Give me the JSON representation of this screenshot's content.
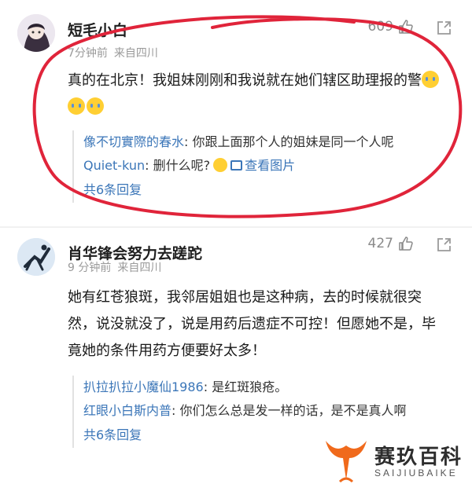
{
  "comments": [
    {
      "username": "短毛小白",
      "time": "7分钟前",
      "location": "来自四川",
      "likes": "609",
      "text": "真的在北京！我姐妹刚刚和我说就在她们辖区助理报的警",
      "replies": [
        {
          "author": "像不切實際的春水",
          "text": ": 你跟上面那个人的姐妹是同一个人呢"
        },
        {
          "author": "Quiet-kun",
          "text": ": 删什么呢?",
          "image_link": "查看图片"
        }
      ],
      "more": "共6条回复"
    },
    {
      "username": "肖华锋会努力去蹉跎",
      "time": "9 分钟前",
      "location": "来自四川",
      "likes": "427",
      "text": "她有红苍狼斑，我邻居姐姐也是这种病，去的时候就很突然，说没就没了，说是用药后遗症不可控！但愿她不是，毕竟她的条件用药方便要好太多！",
      "replies": [
        {
          "author": "扒拉扒拉小魔仙1986",
          "text": ": 是红斑狼疮。"
        },
        {
          "author": "红眼小白斯内普",
          "text": ": 你们怎么总是发一样的话，是不是真人啊"
        }
      ],
      "more": "共6条回复"
    }
  ],
  "watermark": {
    "title": "赛玖百科",
    "subtitle": "SAIJIUBAIKE"
  },
  "colors": {
    "link": "#3b76b8",
    "annotation": "#e0243a",
    "watermark_orange": "#f06a1c"
  }
}
